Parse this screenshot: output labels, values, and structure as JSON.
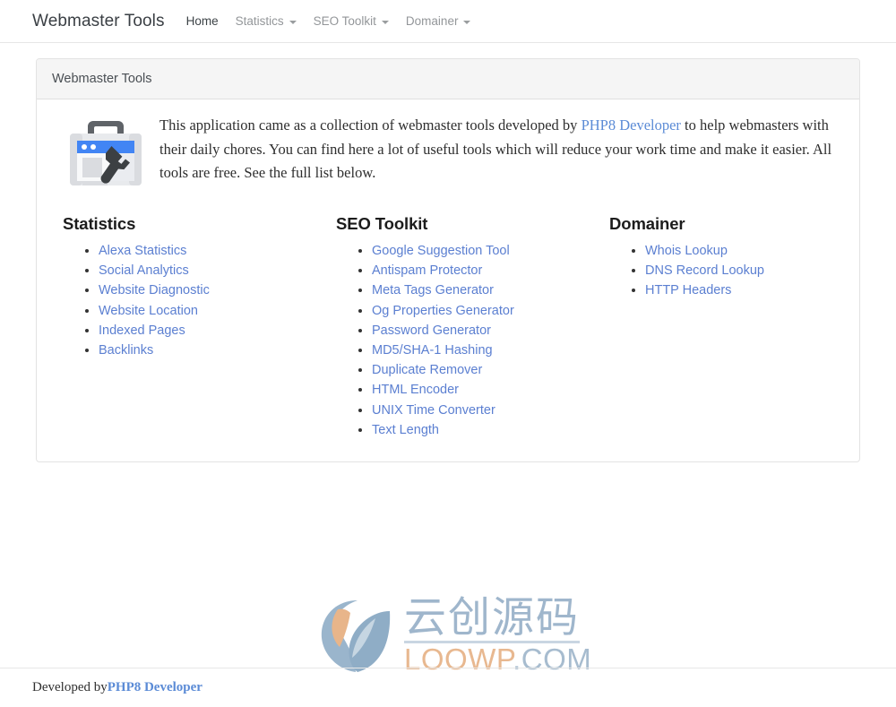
{
  "navbar": {
    "brand": "Webmaster Tools",
    "items": [
      {
        "label": "Home",
        "active": true,
        "has_caret": false
      },
      {
        "label": "Statistics",
        "active": false,
        "has_caret": true
      },
      {
        "label": "SEO Toolkit",
        "active": false,
        "has_caret": true
      },
      {
        "label": "Domainer",
        "active": false,
        "has_caret": true
      }
    ]
  },
  "card": {
    "header_title": "Webmaster Tools",
    "icon_name": "webmaster-toolbox-icon",
    "intro": {
      "before_link": "This application came as a collection of webmaster tools developed by ",
      "link_text": "PHP8 Developer",
      "after_link": " to help webmasters with their daily chores. You can find here a lot of useful tools which will reduce your work time and make it easier. All tools are free. See the full list below."
    }
  },
  "columns": [
    {
      "heading": "Statistics",
      "links": [
        "Alexa Statistics",
        "Social Analytics",
        "Website Diagnostic",
        "Website Location",
        "Indexed Pages",
        "Backlinks"
      ]
    },
    {
      "heading": "SEO Toolkit",
      "links": [
        "Google Suggestion Tool",
        "Antispam Protector",
        "Meta Tags Generator",
        "Og Properties Generator",
        "Password Generator",
        "MD5/SHA-1 Hashing",
        "Duplicate Remover",
        "HTML Encoder",
        "UNIX Time Converter",
        "Text Length"
      ]
    },
    {
      "heading": "Domainer",
      "links": [
        "Whois Lookup",
        "DNS Record Lookup",
        "HTTP Headers"
      ]
    }
  ],
  "watermark": {
    "logo_name": "loowp-leaf-logo",
    "chinese_text": "云创源码",
    "domain_orange": "LOOWP",
    "domain_blue": ".COM"
  },
  "footer": {
    "prefix": "Developed by ",
    "link_text": "PHP8 Developer"
  },
  "colors": {
    "link_blue": "#5b7fd1",
    "brand_text": "#3a3f44",
    "nav_muted": "#939699",
    "card_header_bg": "#f5f5f5",
    "watermark_blue": "#9fb6cc",
    "watermark_orange": "#e8b890",
    "toolbox_blue": "#4285f4",
    "toolbox_gray": "#5f6368"
  }
}
